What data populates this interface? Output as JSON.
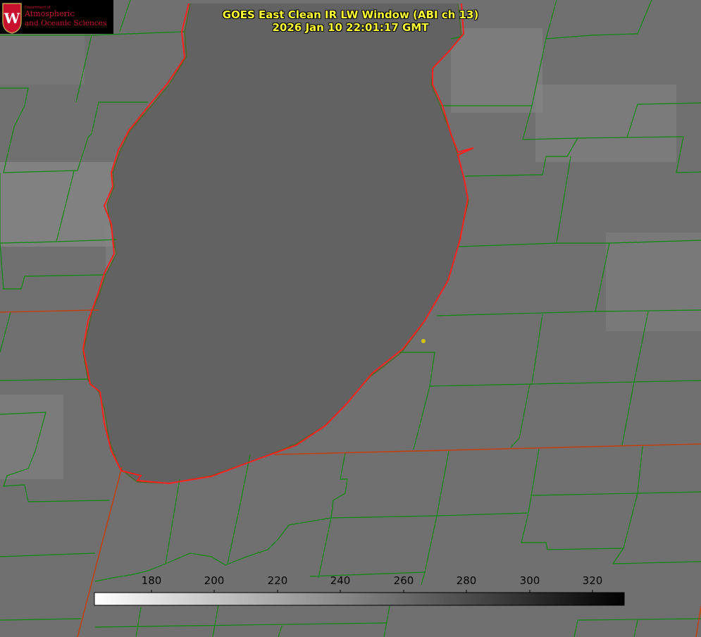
{
  "logo": {
    "dept_small": "Department of",
    "line1": "Atmospheric",
    "line2": "and Oceanic Sciences",
    "crest_letter": "W",
    "crest_color": "#c8102e"
  },
  "title": {
    "line1": "GOES East Clean IR LW Window (ABI ch 13)",
    "line2": "2026 Jan 10 22:01:17 GMT"
  },
  "colorbar": {
    "ticks": [
      "180",
      "200",
      "220",
      "240",
      "260",
      "280",
      "300",
      "320"
    ],
    "gradient": [
      "#ffffff",
      "#000000"
    ]
  },
  "colors": {
    "coastline": "#ff2020",
    "county_lines": "#0b8a0b",
    "state_lines": "#c04010",
    "marker": "#d4c400",
    "title_text": "#ffff33"
  }
}
